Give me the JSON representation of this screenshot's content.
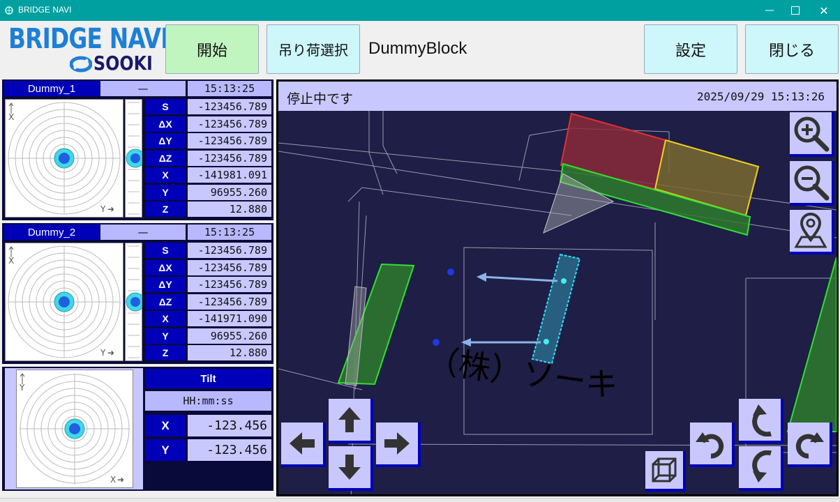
{
  "window": {
    "title": "BRIDGE NAVI"
  },
  "logo": {
    "line1": "BRIDGE NAVI",
    "line2": "SOOKI"
  },
  "toolbar": {
    "start_label": "開始",
    "select_load_label": "吊り荷選択",
    "block_name": "DummyBlock",
    "settings_label": "設定",
    "close_label": "閉じる"
  },
  "sensors": [
    {
      "name": "Dummy_1",
      "status": "—",
      "time": "15:13:25",
      "x_axis": "X",
      "y_axis": "Y",
      "rows": [
        {
          "label": "S",
          "value": "-123456.789"
        },
        {
          "label": "ΔX",
          "value": "-123456.789"
        },
        {
          "label": "ΔY",
          "value": "-123456.789"
        },
        {
          "label": "ΔZ",
          "value": "-123456.789"
        },
        {
          "label": "X",
          "value": "-141981.091"
        },
        {
          "label": "Y",
          "value": "96955.260"
        },
        {
          "label": "Z",
          "value": "12.880"
        }
      ]
    },
    {
      "name": "Dummy_2",
      "status": "—",
      "time": "15:13:25",
      "x_axis": "X",
      "y_axis": "Y",
      "rows": [
        {
          "label": "S",
          "value": "-123456.789"
        },
        {
          "label": "ΔX",
          "value": "-123456.789"
        },
        {
          "label": "ΔY",
          "value": "-123456.789"
        },
        {
          "label": "ΔZ",
          "value": "-123456.789"
        },
        {
          "label": "X",
          "value": "-141971.090"
        },
        {
          "label": "Y",
          "value": "96955.260"
        },
        {
          "label": "Z",
          "value": "12.880"
        }
      ]
    }
  ],
  "tilt": {
    "title": "Tilt",
    "time": "HH:mm:ss",
    "x_label": "X",
    "x_value": "-123.456",
    "y_label": "Y",
    "y_value": "-123.456",
    "x_axis": "X",
    "y_axis": "Y"
  },
  "map": {
    "status": "停止中です",
    "datetime": "2025/09/29 15:13:26",
    "watermark": "（株）ソーキ"
  },
  "colors": {
    "accent": "#0000b8",
    "lavender": "#c8c8ff",
    "start_green": "#c0f5c0",
    "button_cyan": "#cdf7fa",
    "map_bg": "#1e1e46"
  }
}
